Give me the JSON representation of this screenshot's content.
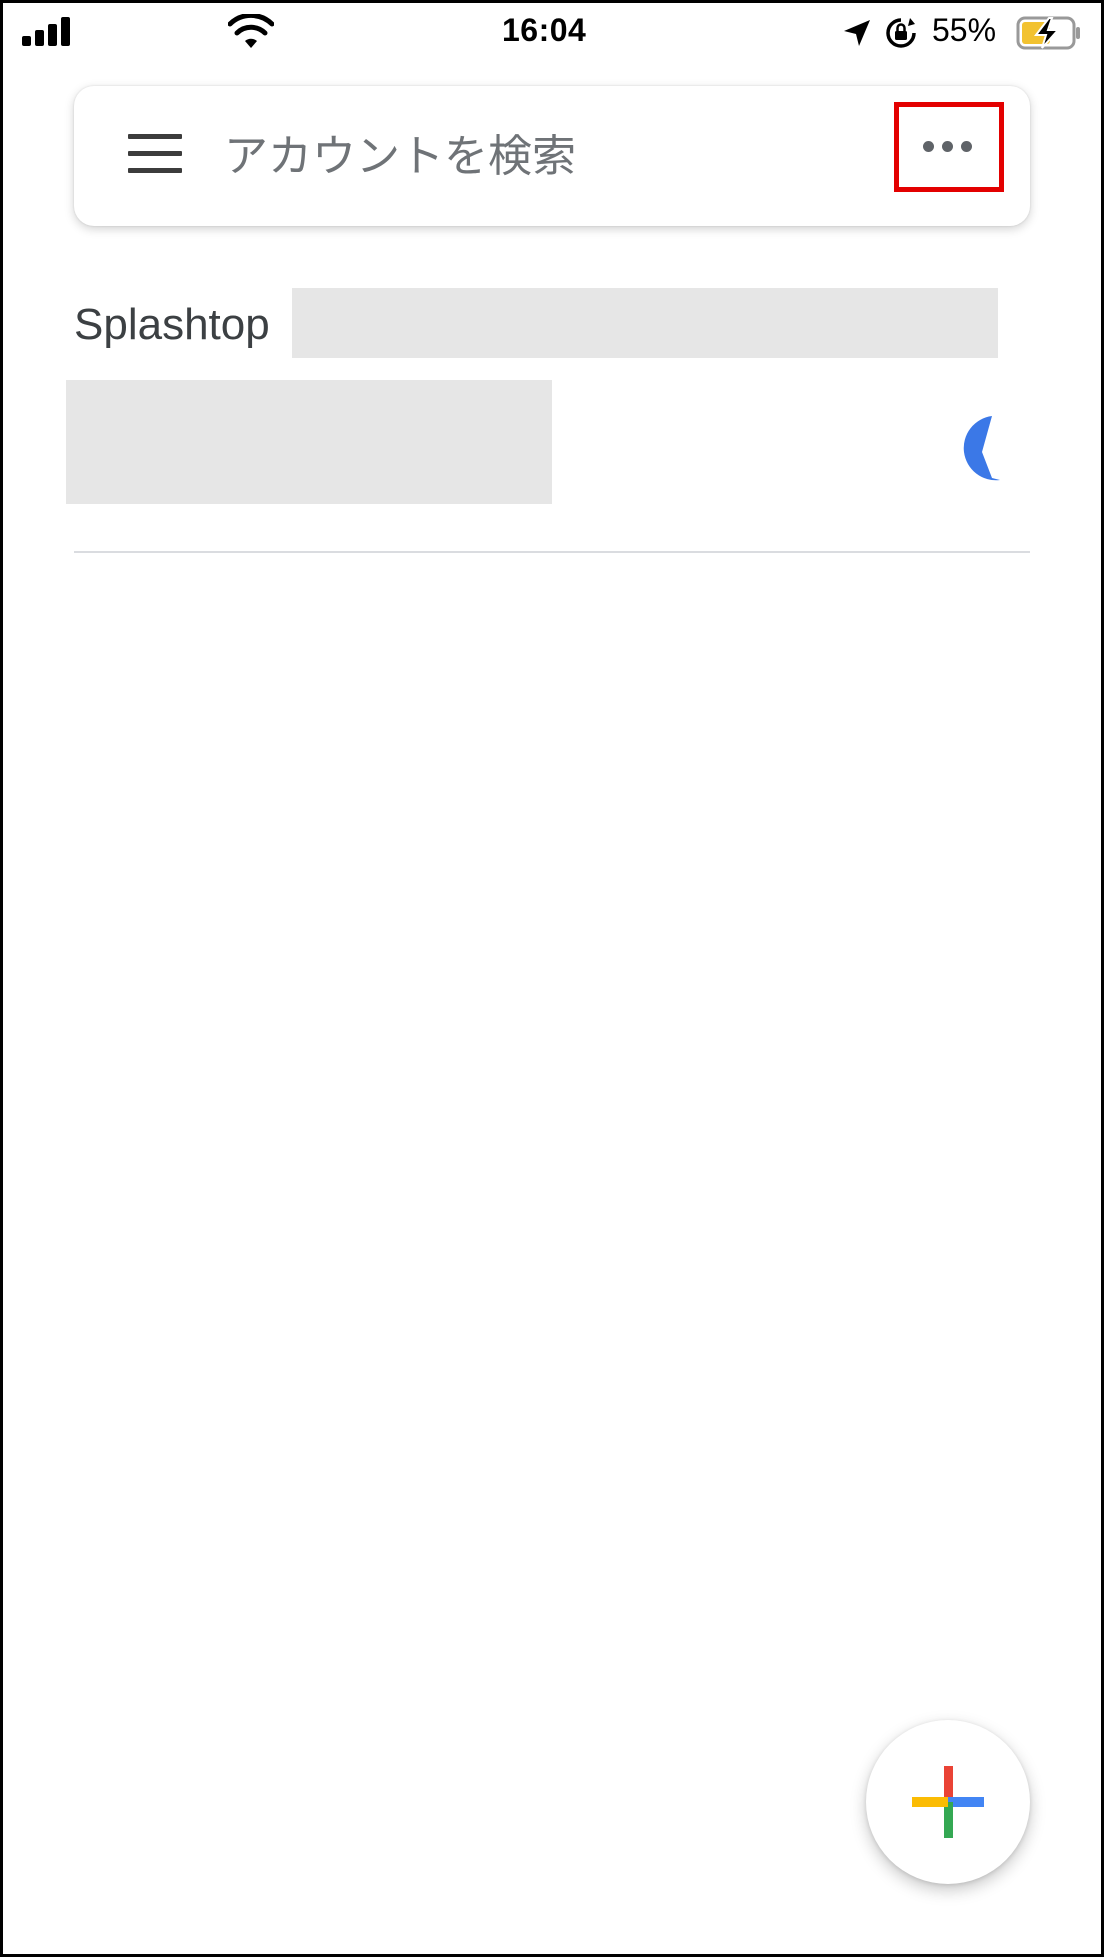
{
  "status_bar": {
    "time": "16:04",
    "battery_percent": "55%",
    "battery_level": 0.55,
    "icons": [
      "signal-icon",
      "wifi-icon",
      "location-arrow-icon",
      "rotation-lock-icon",
      "battery-charging-icon"
    ]
  },
  "search": {
    "placeholder": "アカウントを検索",
    "menu_icon": "hamburger-menu-icon",
    "more_icon": "more-horizontal-icon",
    "highlight_color": "#e30000"
  },
  "accounts": [
    {
      "issuer": "Splashtop",
      "timer_icon": "countdown-timer-icon",
      "timer_color": "#3b78e7"
    }
  ],
  "fab": {
    "icon": "add-plus-icon",
    "colors": {
      "red": "#ea4335",
      "blue": "#4285f4",
      "green": "#34a853",
      "yellow": "#fbbc04"
    }
  }
}
